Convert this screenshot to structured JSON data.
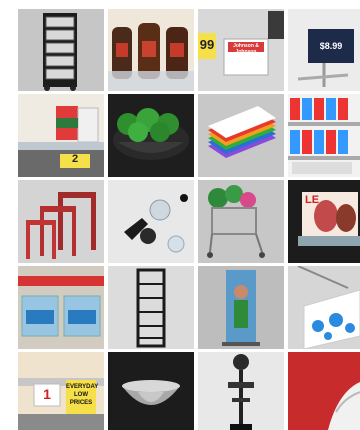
{
  "tiles": [
    {
      "name": "rolling-drawer-cart"
    },
    {
      "name": "syrup-bottle-tray"
    },
    {
      "name": "price-sign-holders",
      "price_text": "99",
      "sign_text": "Johnson & Johnson"
    },
    {
      "name": "sign-holder-clip",
      "price_text": "$8.99"
    },
    {
      "name": "shelf-divider-products",
      "tag_text": "2"
    },
    {
      "name": "produce-bowl"
    },
    {
      "name": "colored-plastic-sheets"
    },
    {
      "name": "shelf-product-pushers"
    },
    {
      "name": "nesting-tables"
    },
    {
      "name": "shelf-clips"
    },
    {
      "name": "floral-cart"
    },
    {
      "name": "acrylic-sign-frame",
      "frame_text": "LE"
    },
    {
      "name": "pegboard-baskets"
    },
    {
      "name": "black-shelving-unit"
    },
    {
      "name": "banner-stand"
    },
    {
      "name": "hanging-sign-clip"
    },
    {
      "name": "shelf-price-tags",
      "tag_text": "EVERYDAY LOW PRICES",
      "price_text": "1"
    },
    {
      "name": "steel-bowl"
    },
    {
      "name": "display-stand"
    },
    {
      "name": "curled-sign-corner"
    }
  ]
}
